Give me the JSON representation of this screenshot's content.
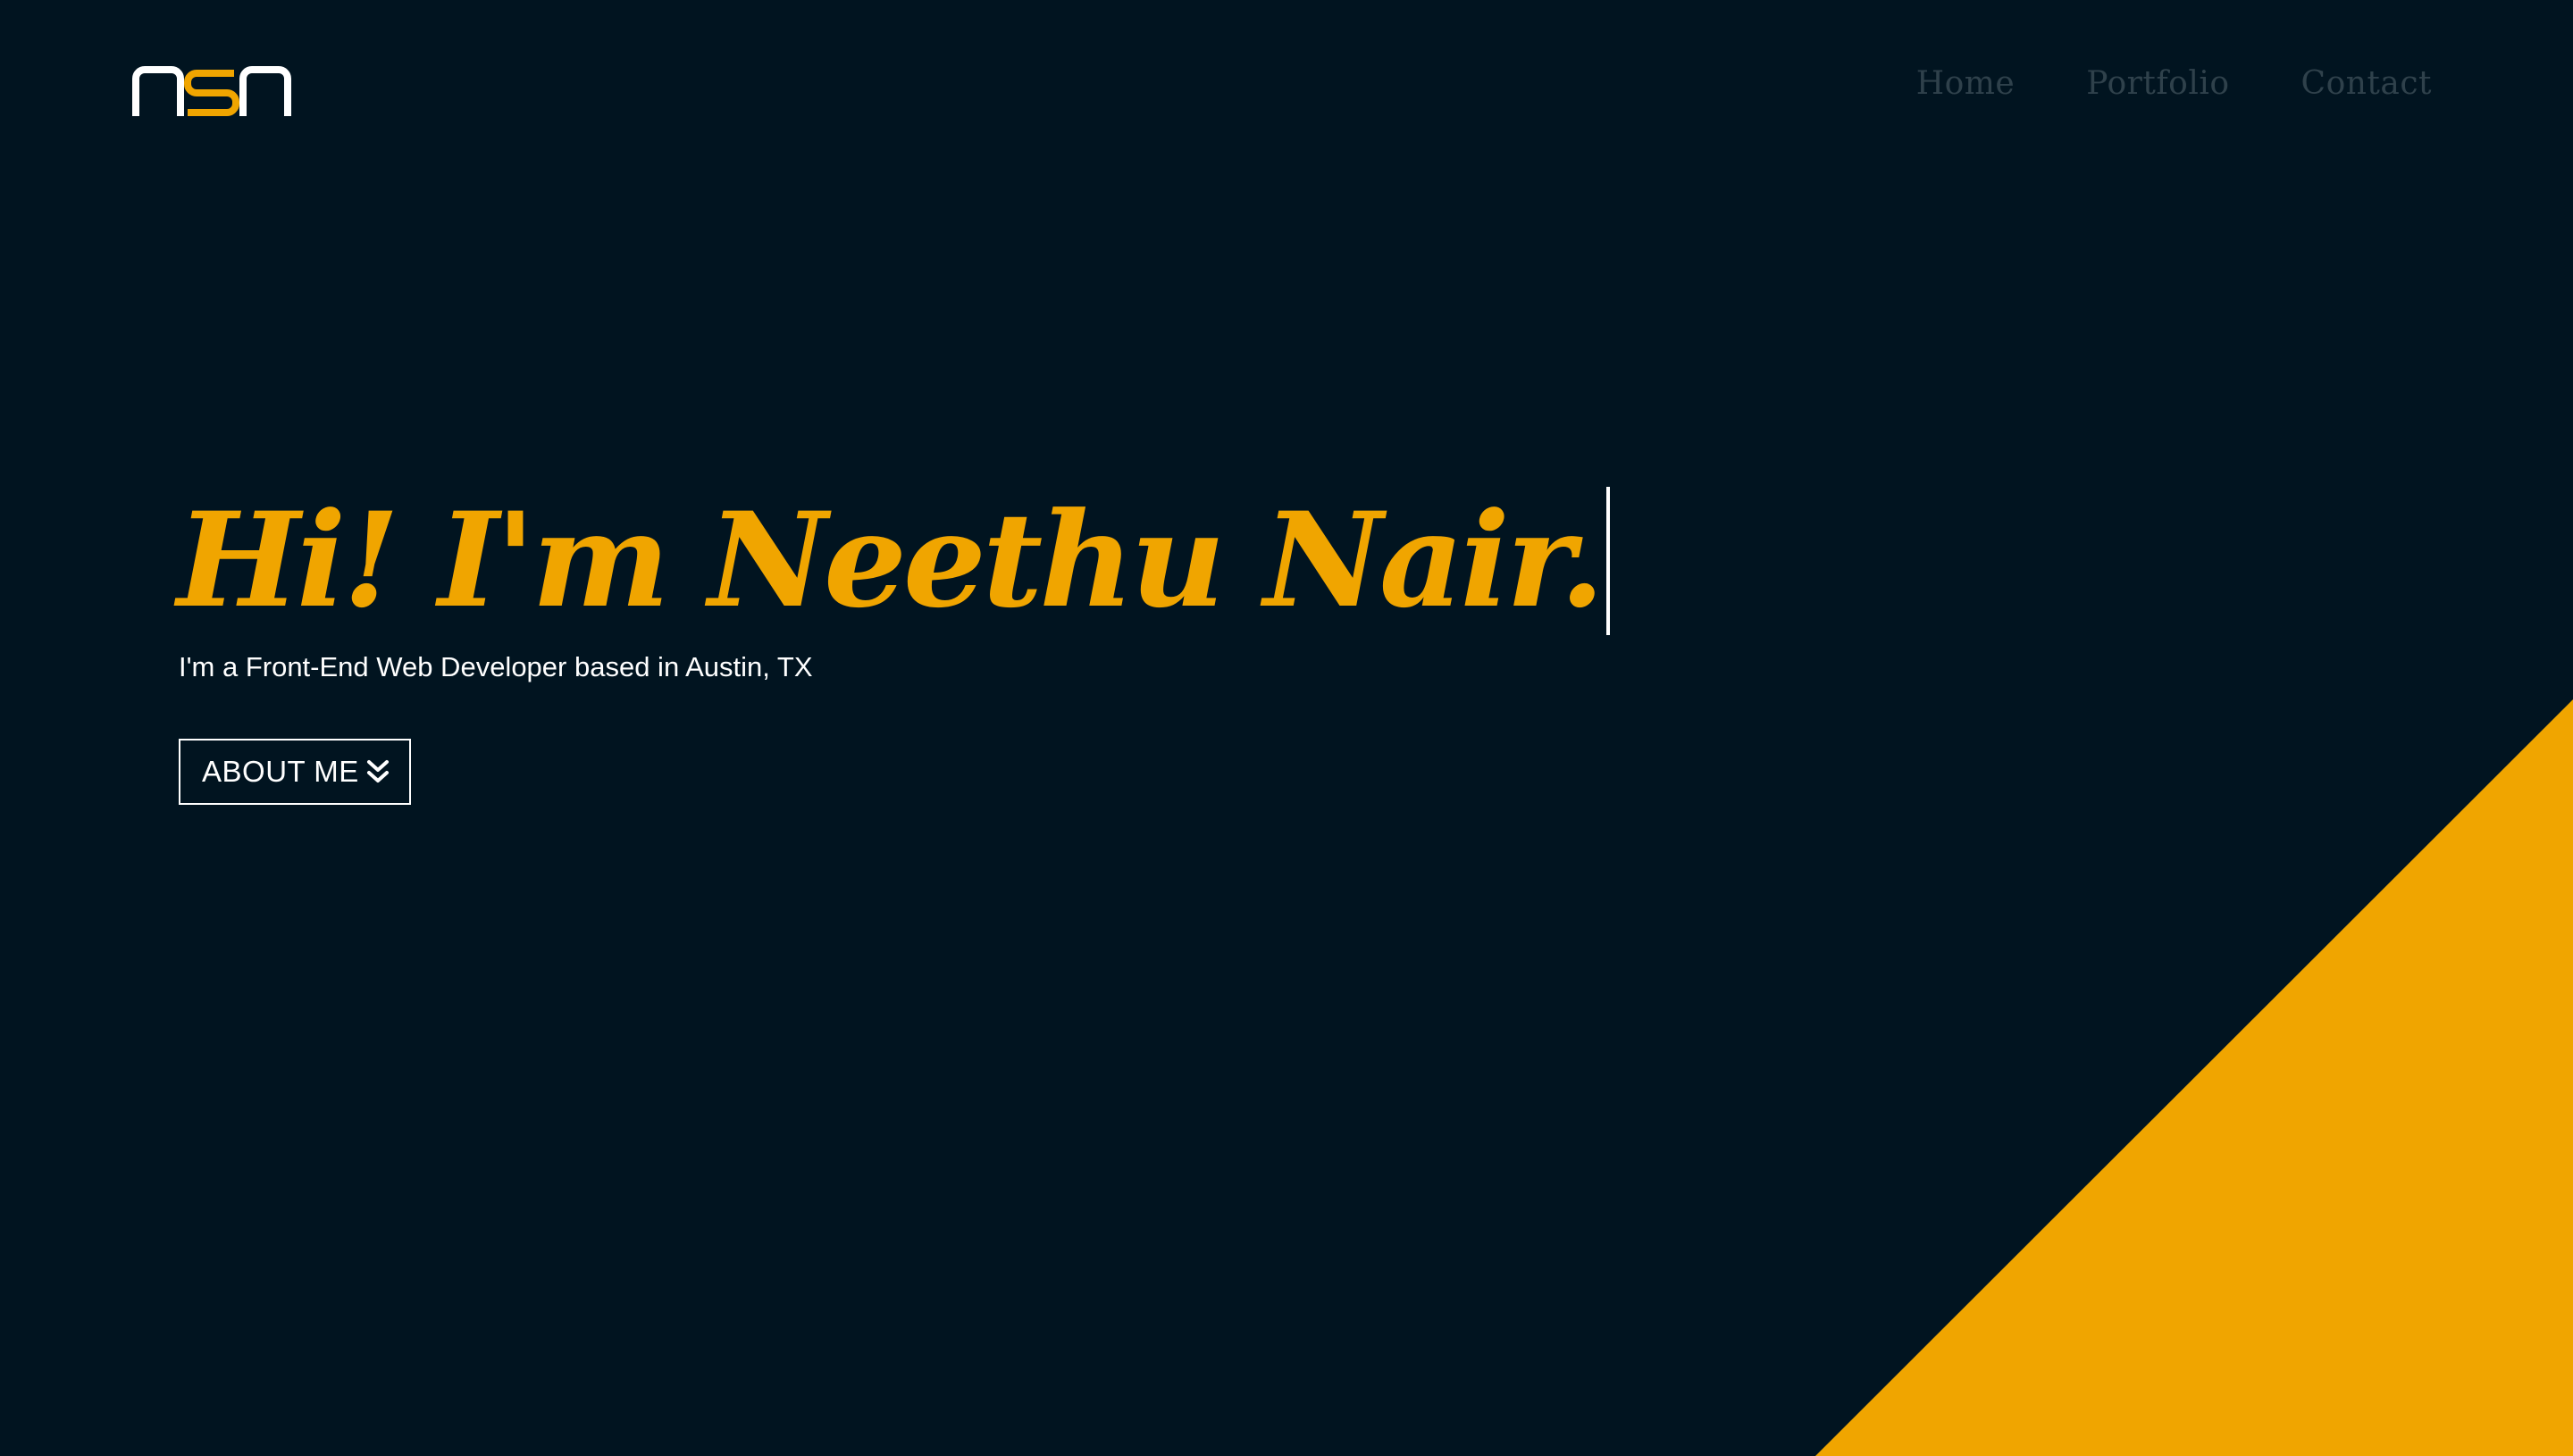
{
  "header": {
    "logo": {
      "text": "nsn",
      "icon": "nsn-logo-icon",
      "colors": {
        "outer": "#ffffff",
        "middle": "#f0a500"
      }
    },
    "nav": [
      {
        "label": "Home"
      },
      {
        "label": "Portfolio"
      },
      {
        "label": "Contact"
      }
    ]
  },
  "hero": {
    "title": "Hi! I'm Neethu Nair.",
    "subtitle": "I'm a Front-End Web Developer based in Austin, TX",
    "button": {
      "label": "ABOUT ME",
      "icon": "double-chevron-down-icon"
    }
  },
  "theme": {
    "background": "#011420",
    "accent": "#f0a500",
    "nav_text": "#2f414b",
    "text": "#ffffff"
  }
}
